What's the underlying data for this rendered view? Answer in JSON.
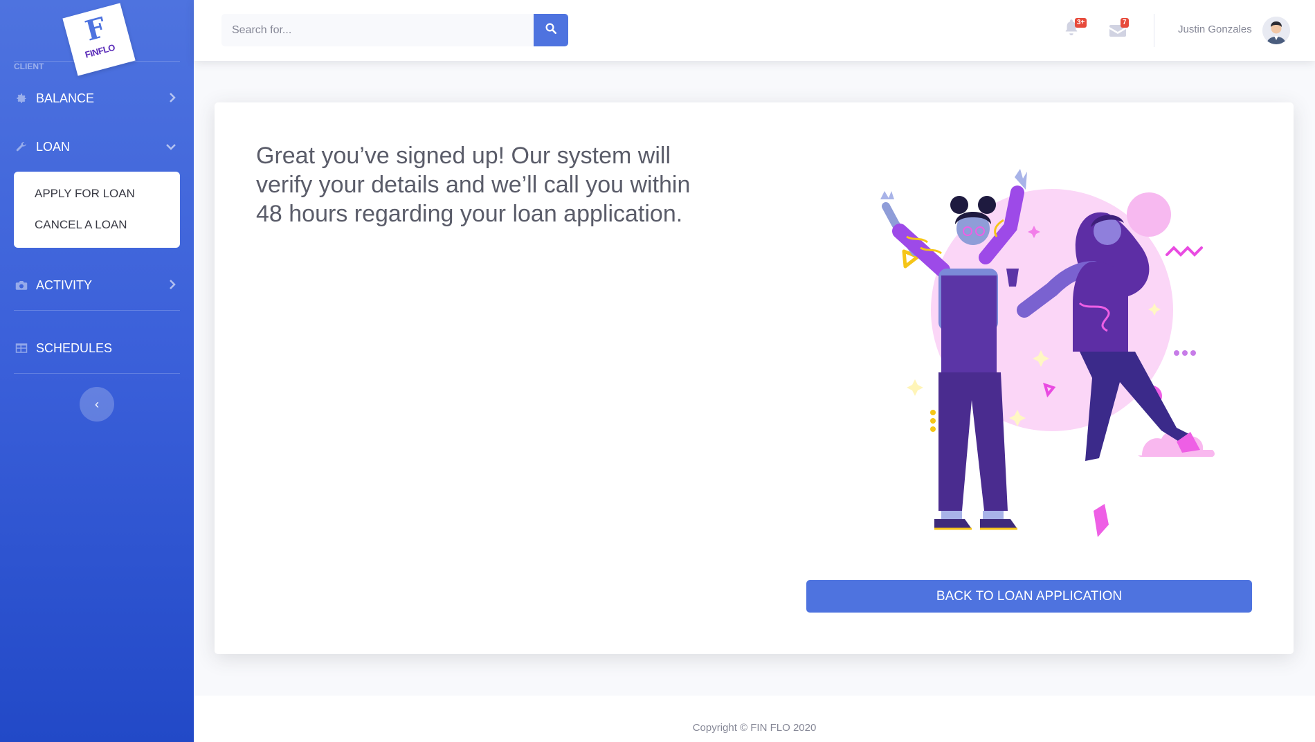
{
  "brand": {
    "letter": "F",
    "name": "FINFLO"
  },
  "sidebar": {
    "heading": "CLIENT",
    "items": [
      {
        "label": "BALANCE",
        "icon": "gear-icon"
      },
      {
        "label": "LOAN",
        "icon": "wrench-icon"
      },
      {
        "label": "ACTIVITY",
        "icon": "camera-icon"
      },
      {
        "label": "SCHEDULES",
        "icon": "table-icon"
      }
    ],
    "loan_submenu": [
      "APPLY FOR LOAN",
      "CANCEL A LOAN"
    ],
    "toggle_glyph": "‹"
  },
  "topbar": {
    "search_placeholder": "Search for...",
    "alerts_badge": "3+",
    "messages_badge": "7",
    "user_name": "Justin Gonzales"
  },
  "card": {
    "message": "Great you’ve signed up! Our system will verify your details and we’ll call you within 48 hours regarding your loan application.",
    "button_label": "BACK TO LOAN APPLICATION"
  },
  "footer": {
    "copyright": "Copyright © FIN FLO 2020"
  },
  "colors": {
    "primary": "#4e73df",
    "badge": "#e74a3b",
    "text": "#5a5c69"
  }
}
